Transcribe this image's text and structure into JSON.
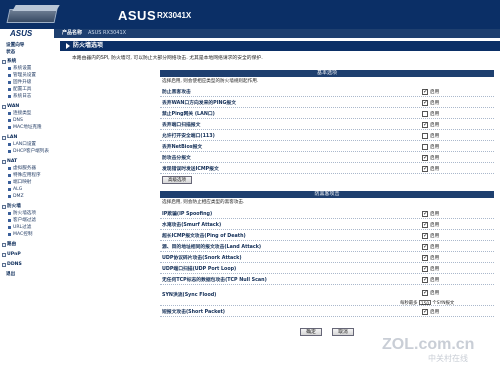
{
  "header": {
    "brand": "ASUS",
    "model": "RX3041X"
  },
  "strip": {
    "logo": "ASUS",
    "product_label": "产品名称",
    "product_name": "ASUS RX3041X"
  },
  "sidebar": {
    "items": [
      {
        "label": "设置向导",
        "kind": "top"
      },
      {
        "label": "状态",
        "kind": "top"
      },
      {
        "label": "系统",
        "kind": "sec"
      },
      {
        "label": "系统设置",
        "kind": "sub"
      },
      {
        "label": "管理员设置",
        "kind": "sub"
      },
      {
        "label": "固件升级",
        "kind": "sub"
      },
      {
        "label": "配置工具",
        "kind": "sub"
      },
      {
        "label": "系统日志",
        "kind": "sub"
      },
      {
        "label": "WAN",
        "kind": "sec"
      },
      {
        "label": "连接类型",
        "kind": "sub"
      },
      {
        "label": "DNS",
        "kind": "sub"
      },
      {
        "label": "MAC地址克隆",
        "kind": "sub"
      },
      {
        "label": "LAN",
        "kind": "sec"
      },
      {
        "label": "LAN口设置",
        "kind": "sub"
      },
      {
        "label": "DHCP客户端列表",
        "kind": "sub"
      },
      {
        "label": "NAT",
        "kind": "sec"
      },
      {
        "label": "虚拟服务器",
        "kind": "sub"
      },
      {
        "label": "特殊应用程序",
        "kind": "sub"
      },
      {
        "label": "端口映射",
        "kind": "sub"
      },
      {
        "label": "ALG",
        "kind": "sub"
      },
      {
        "label": "DMZ",
        "kind": "sub"
      },
      {
        "label": "防火墙",
        "kind": "sec"
      },
      {
        "label": "防火墙选项",
        "kind": "sub"
      },
      {
        "label": "客户端过滤",
        "kind": "sub"
      },
      {
        "label": "URL过滤",
        "kind": "sub"
      },
      {
        "label": "MAC控制",
        "kind": "sub"
      },
      {
        "label": "路由",
        "kind": "sec"
      },
      {
        "label": "UPnP",
        "kind": "sec"
      },
      {
        "label": "DDNS",
        "kind": "sec"
      },
      {
        "label": "退出",
        "kind": "top"
      }
    ]
  },
  "page": {
    "title": "防火墙选项",
    "intro": "本路由器内的SPI, 防火墙可, 可以防止大部分网络攻击. 尤其是本地网络请求的安全的保护."
  },
  "basic": {
    "heading": "基本选项",
    "desc": "选择启用, 则会使相应类型的防火墙规则起作用.",
    "rows": [
      {
        "label": "防止黑客攻击",
        "checked": true
      },
      {
        "label": "丢弃WAN口方向发来的PING报文",
        "checked": true
      },
      {
        "label": "禁止Ping网关 (LAN口)",
        "checked": false
      },
      {
        "label": "丢弃端口扫描报文",
        "checked": true
      },
      {
        "label": "允许打开安全端口(113)",
        "checked": false
      },
      {
        "label": "丢弃NetBios报文",
        "checked": false
      },
      {
        "label": "防攻击分报文",
        "checked": true
      },
      {
        "label": "发现错误时发送ICMP报文",
        "checked": true
      }
    ],
    "advanced_button": "高级选项"
  },
  "defense": {
    "heading": "防黑客攻击",
    "desc": "选择启用, 则会防止相应类型的黑客攻击.",
    "rows": [
      {
        "label": "IP欺骗(IP Spoofing)",
        "checked": true
      },
      {
        "label": "水淹攻击(Smurf Attack)",
        "checked": true
      },
      {
        "label": "超长ICMP报文攻击(Ping of Death)",
        "checked": true
      },
      {
        "label": "源、目的地址相同的报文攻击(Land Attack)",
        "checked": true
      },
      {
        "label": "UDP协议碎片攻击(Snork Attack)",
        "checked": true
      },
      {
        "label": "UDP端口扫描(UDP Port Loop)",
        "checked": true
      },
      {
        "label": "无任何TCP标志的数据包攻击(TCP Null Scan)",
        "checked": true
      },
      {
        "label": "SYN洪流(Sync Flood)",
        "checked": true
      },
      {
        "label": "短报文攻击(Short Packet)",
        "checked": true
      }
    ],
    "syn_prefix": "每秒最多",
    "syn_value": "150",
    "syn_suffix": "个SYN报文"
  },
  "common": {
    "enable_label": "启用",
    "ok_label": "确定",
    "cancel_label": "取消"
  },
  "watermark": {
    "main": "ZOL.com.cn",
    "sub": "中关村在线"
  }
}
